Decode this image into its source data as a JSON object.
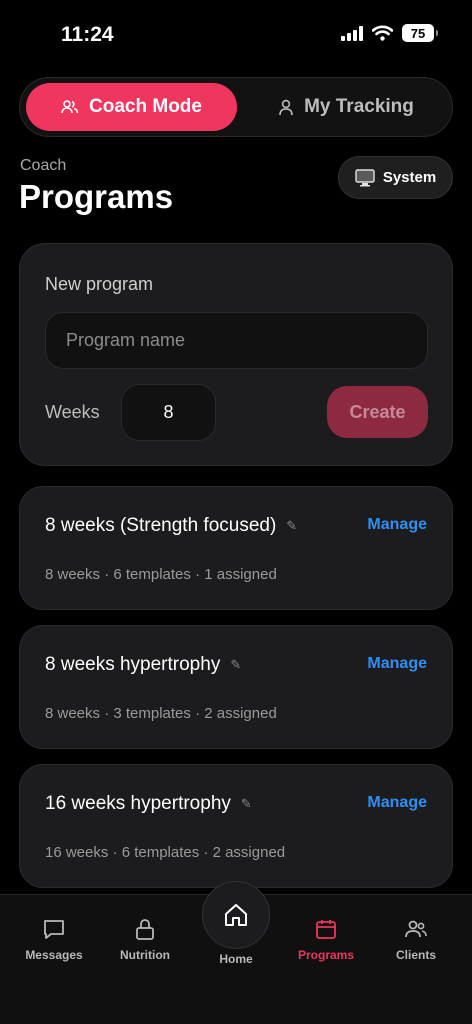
{
  "status": {
    "time": "11:24",
    "battery": "75"
  },
  "mode_toggle": {
    "coach_label": "Coach Mode",
    "tracking_label": "My Tracking",
    "active": "coach"
  },
  "header": {
    "section": "Coach",
    "title": "Programs",
    "system_label": "System"
  },
  "new_program": {
    "label": "New program",
    "name_placeholder": "Program name",
    "name_value": "",
    "weeks_label": "Weeks",
    "weeks_value": "8",
    "create_label": "Create"
  },
  "programs": [
    {
      "title": "8 weeks (Strength focused)",
      "meta": "8 weeks · 6 templates · 1 assigned",
      "action": "Manage"
    },
    {
      "title": "8 weeks hypertrophy",
      "meta": "8 weeks · 3 templates · 2 assigned",
      "action": "Manage"
    },
    {
      "title": "16 weeks hypertrophy",
      "meta": "16 weeks · 6 templates · 2 assigned",
      "action": "Manage"
    }
  ],
  "tabs": [
    {
      "label": "Messages",
      "icon": "chat-bubble-icon"
    },
    {
      "label": "Nutrition",
      "icon": "lock-icon"
    },
    {
      "label": "Home",
      "icon": "home-icon"
    },
    {
      "label": "Programs",
      "icon": "calendar-icon",
      "active": true
    },
    {
      "label": "Clients",
      "icon": "users-icon"
    }
  ],
  "colors": {
    "accent": "#f0355e",
    "link": "#2f8ff5",
    "card": "#1c1c1e",
    "background": "#000000"
  }
}
